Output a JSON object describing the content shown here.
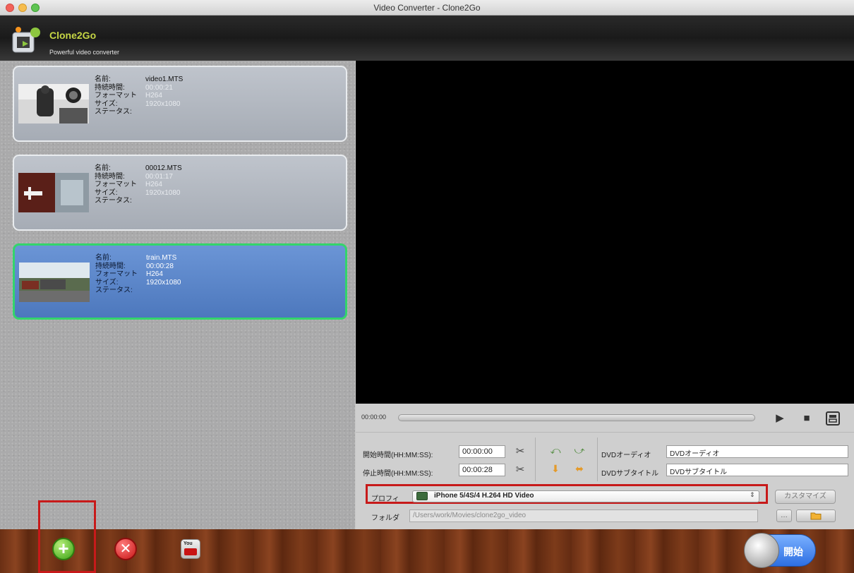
{
  "window": {
    "title": "Video Converter - Clone2Go"
  },
  "brand": {
    "name": "Clone2Go",
    "tagline": "Powerful video converter"
  },
  "labels": {
    "name": "名前:",
    "duration": "持続時間:",
    "format": "フォーマット",
    "size": "サイズ:",
    "status": "ステータス:"
  },
  "files": [
    {
      "name": "video1.MTS",
      "duration": "00:00:21",
      "format": "H264",
      "size": "1920x1080",
      "status": "",
      "selected": false
    },
    {
      "name": "00012.MTS",
      "duration": "00:01:17",
      "format": "H264",
      "size": "1920x1080",
      "status": "",
      "selected": false
    },
    {
      "name": "train.MTS",
      "duration": "00:00:28",
      "format": "H264",
      "size": "1920x1080",
      "status": "",
      "selected": true
    }
  ],
  "player": {
    "time": "00:00:00"
  },
  "trim": {
    "start_label": "開始時間(HH:MM:SS):",
    "start_value": "00:00:00",
    "stop_label": "停止時間(HH:MM:SS):",
    "stop_value": "00:00:28"
  },
  "dvd": {
    "audio_label": "DVDオーディオ",
    "audio_value": "DVDオーディオ",
    "subtitle_label": "DVDサブタイトル",
    "subtitle_value": "DVDサブタイトル"
  },
  "profile": {
    "label": "プロフィ",
    "value": "iPhone 5/4S/4 H.264 HD Video"
  },
  "folder": {
    "label": "フォルダ",
    "value": "/Users/work/Movies/clone2go_video"
  },
  "buttons": {
    "customize": "カスタマイズ",
    "start": "開始"
  },
  "colors": {
    "highlight": "#c71a1a",
    "selected_card": "#5b86cc",
    "selected_border": "#33d56b",
    "brand_green": "#c6d645"
  }
}
